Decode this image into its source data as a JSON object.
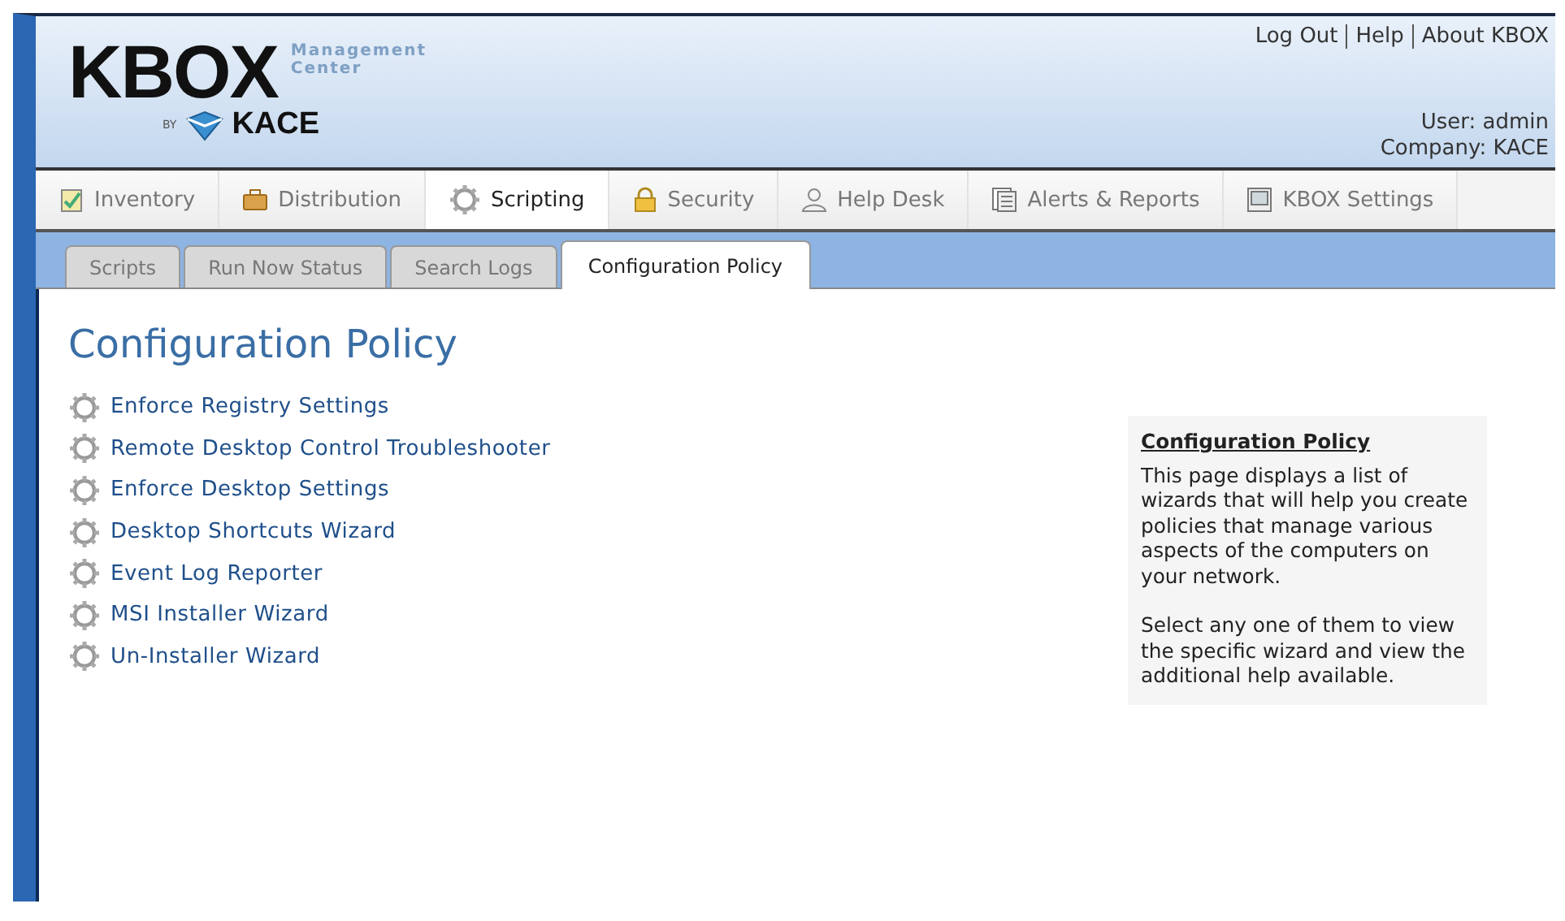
{
  "logo": {
    "name": "KBOX",
    "tagline_1": "Management",
    "tagline_2": "Center",
    "by": "BY",
    "maker": "KACE"
  },
  "top_links": [
    "Log Out",
    "Help",
    "About KBOX"
  ],
  "user": "User: admin",
  "company": "Company: KACE",
  "nav": [
    {
      "label": "Inventory",
      "kind": "clipboard",
      "selected": false
    },
    {
      "label": "Distribution",
      "kind": "briefcase",
      "selected": false
    },
    {
      "label": "Scripting",
      "kind": "gear",
      "selected": true
    },
    {
      "label": "Security",
      "kind": "lock",
      "selected": false
    },
    {
      "label": "Help Desk",
      "kind": "person",
      "selected": false
    },
    {
      "label": "Alerts & Reports",
      "kind": "document",
      "selected": false
    },
    {
      "label": "KBOX Settings",
      "kind": "monitor",
      "selected": false
    }
  ],
  "subtabs": [
    {
      "label": "Scripts",
      "selected": false
    },
    {
      "label": "Run Now Status",
      "selected": false
    },
    {
      "label": "Search Logs",
      "selected": false
    },
    {
      "label": "Configuration Policy",
      "selected": true
    }
  ],
  "page_title": "Configuration Policy",
  "wizards": [
    "Enforce Registry Settings",
    "Remote Desktop Control Troubleshooter",
    "Enforce Desktop Settings",
    "Desktop Shortcuts Wizard",
    "Event Log Reporter",
    "MSI Installer Wizard",
    "Un-Installer Wizard"
  ],
  "help": {
    "title": "Configuration Policy",
    "paragraphs": [
      "This page displays a list of wizards that will help you create policies that manage various aspects of the computers on your network.",
      "Select any one of them to view the specific wizard and view the additional help available."
    ]
  }
}
